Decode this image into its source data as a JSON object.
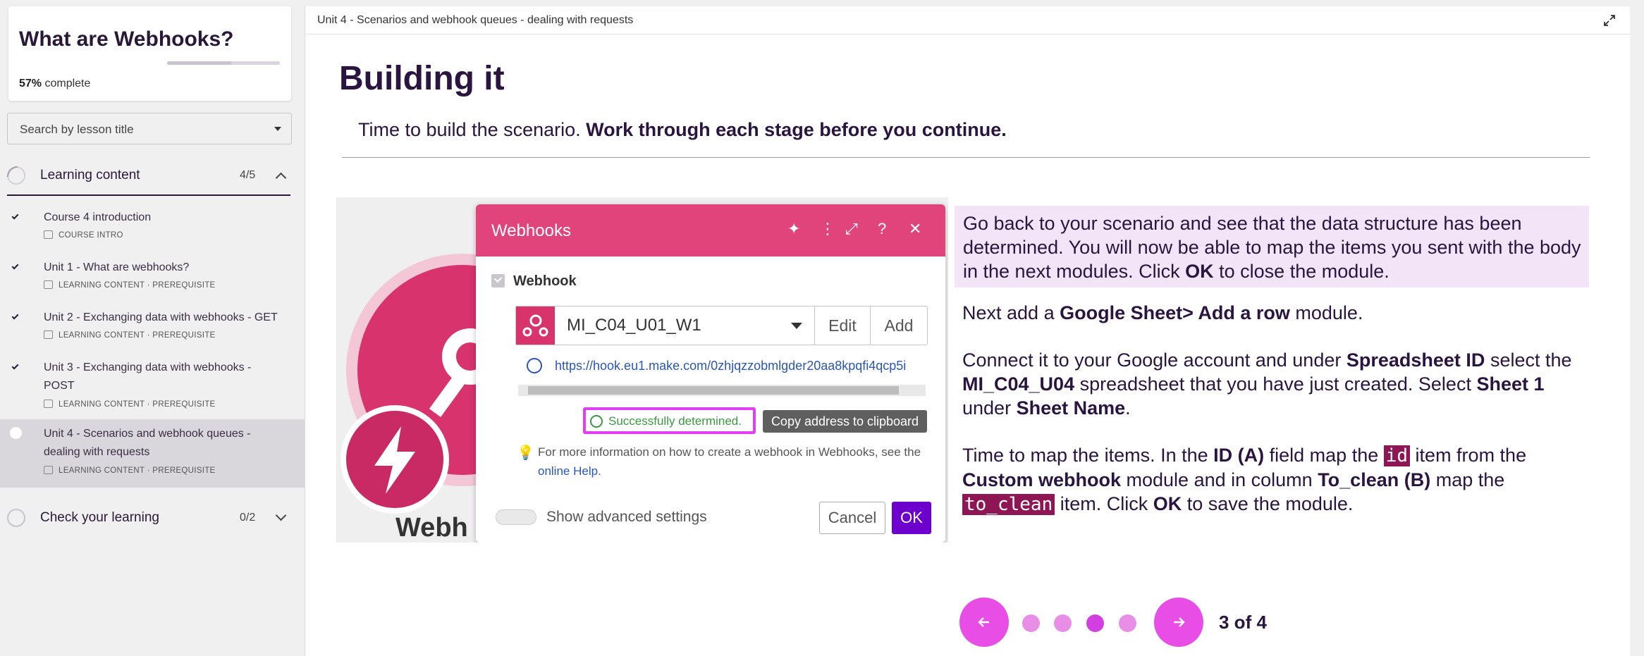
{
  "course": {
    "title": "What are Webhooks?",
    "progress_percent": 57,
    "progress_value": "57%",
    "progress_suffix": " complete"
  },
  "search": {
    "placeholder": "Search by lesson title"
  },
  "sections": [
    {
      "label": "Learning content",
      "count": "4/5",
      "expanded": true
    },
    {
      "label": "Check your learning",
      "count": "0/2",
      "expanded": false
    }
  ],
  "lessons": [
    {
      "title": "Course 4 introduction",
      "meta": "COURSE INTRO",
      "completed": true
    },
    {
      "title": "Unit 1 - What are webhooks?",
      "meta": "LEARNING CONTENT · PREREQUISITE",
      "completed": true
    },
    {
      "title": "Unit 2 - Exchanging data with webhooks - GET",
      "meta": "LEARNING CONTENT · PREREQUISITE",
      "completed": true
    },
    {
      "title": "Unit 3 - Exchanging data with webhooks - POST",
      "meta": "LEARNING CONTENT · PREREQUISITE",
      "completed": true
    },
    {
      "title": "Unit 4 - Scenarios and webhook queues - dealing with requests",
      "meta": "LEARNING CONTENT · PREREQUISITE",
      "completed": false,
      "active": true
    }
  ],
  "main": {
    "breadcrumb": "Unit 4 - Scenarios and webhook queues - dealing with requests",
    "title": "Building it",
    "subtitle_plain": "Time to build the scenario. ",
    "subtitle_bold": "Work through each stage before you continue."
  },
  "dialog": {
    "title": "Webhooks",
    "section_label": "Webhook",
    "selected_hook": "MI_C04_U01_W1",
    "edit_label": "Edit",
    "add_label": "Add",
    "url": "https://hook.eu1.make.com/0zhjqzzobmlgder20aa8kpqfi4qcp5i",
    "status": "Successfully determined.",
    "copy_label": "Copy address to clipboard",
    "info_text": "For more information on how to create a webhook in Webhooks, see the ",
    "info_link": "online Help",
    "info_end": ".",
    "advanced_label": "Show advanced settings",
    "cancel_label": "Cancel",
    "ok_label": "OK",
    "bg_label": "Webh"
  },
  "steps": {
    "p1_a": "Go back to your scenario and see that the data structure has been determined. You will now be able to map the items you sent with the body in the next modules. Click ",
    "p1_b": "OK",
    "p1_c": " to close the module.",
    "p2_a": "Next add a ",
    "p2_b": "Google Sheet> Add a row",
    "p2_c": " module.",
    "p3_a": "Connect it to your Google account and under ",
    "p3_b": "Spreadsheet ID",
    "p3_c": " select the ",
    "p3_d": "MI_C04_U04",
    "p3_e": " spreadsheet that you have just created. Select ",
    "p3_f": "Sheet 1",
    "p3_g": " under ",
    "p3_h": "Sheet Name",
    "p3_i": ".",
    "p4_a": "Time to map the items. In the ",
    "p4_b": "ID (A)",
    "p4_c": " field map the ",
    "p4_code1": "id",
    "p4_d": " item from the ",
    "p4_e": "Custom webhook",
    "p4_f": " module and in column ",
    "p4_g": "To_clean (B)",
    "p4_h": " map the ",
    "p4_code2": "to_clean",
    "p4_i": "  item. Click ",
    "p4_j": "OK",
    "p4_k": " to save the module."
  },
  "pagination": {
    "current": 3,
    "total": 4,
    "label": "3 of 4"
  },
  "colors": {
    "accent": "#e84ee6",
    "brand_pink": "#e0447a",
    "highlight": "#f3e5f7",
    "code_bg": "#8f1655"
  }
}
